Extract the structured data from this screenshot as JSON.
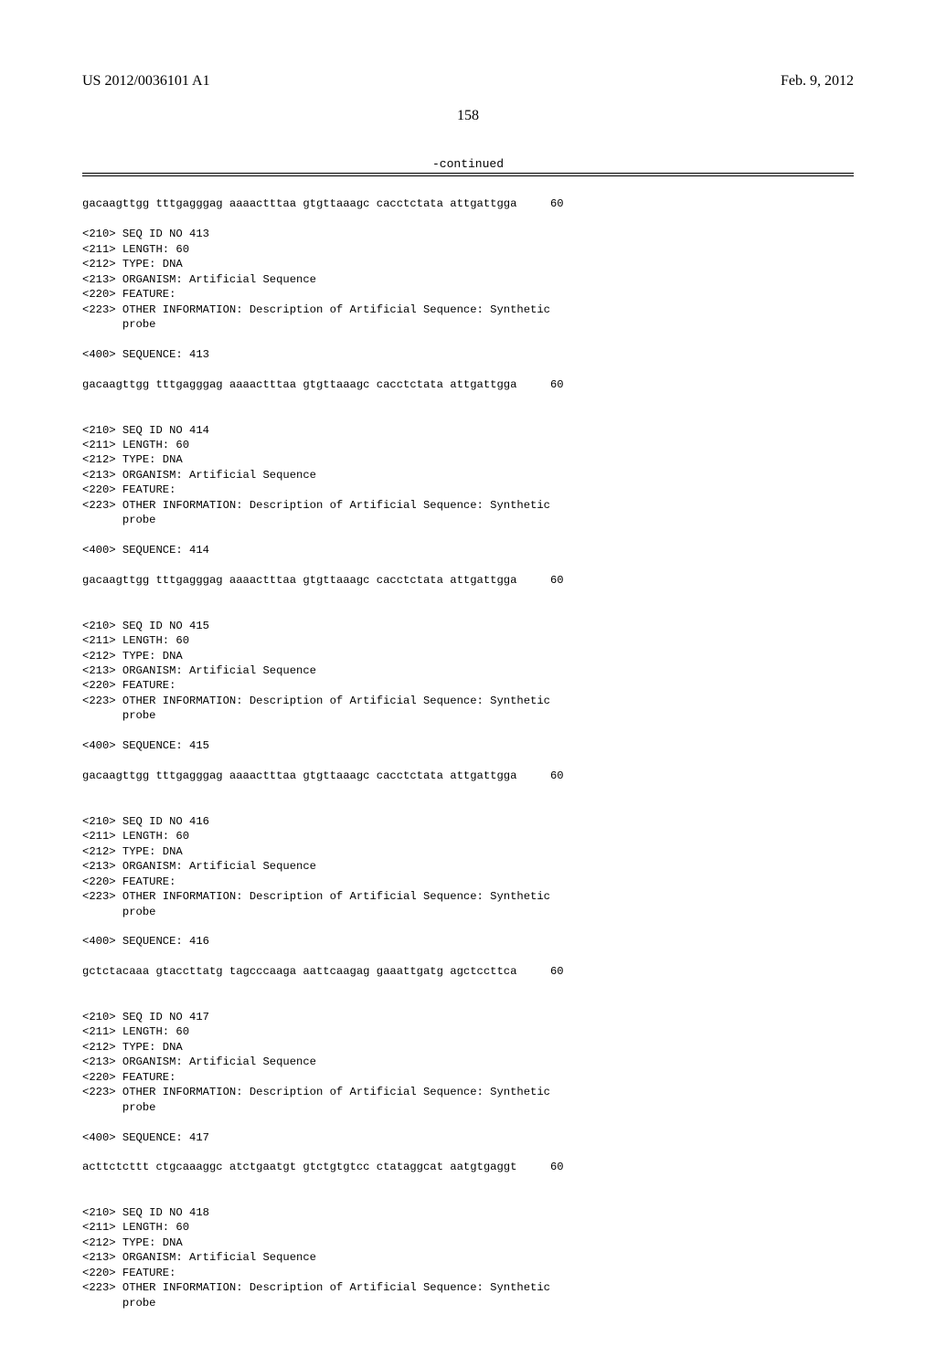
{
  "header": {
    "pub_number": "US 2012/0036101 A1",
    "pub_date": "Feb. 9, 2012"
  },
  "page_number": "158",
  "continued_label": "-continued",
  "entries": [
    {
      "pre_sequence": {
        "text": "gacaagttgg tttgagggag aaaactttaa gtgttaaagc cacctctata attgattgga",
        "num": "60"
      },
      "header": [
        "<210> SEQ ID NO 413",
        "<211> LENGTH: 60",
        "<212> TYPE: DNA",
        "<213> ORGANISM: Artificial Sequence",
        "<220> FEATURE:",
        "<223> OTHER INFORMATION: Description of Artificial Sequence: Synthetic",
        "      probe"
      ],
      "seq_label": "<400> SEQUENCE: 413",
      "sequence": {
        "text": "gacaagttgg tttgagggag aaaactttaa gtgttaaagc cacctctata attgattgga",
        "num": "60"
      }
    },
    {
      "header": [
        "<210> SEQ ID NO 414",
        "<211> LENGTH: 60",
        "<212> TYPE: DNA",
        "<213> ORGANISM: Artificial Sequence",
        "<220> FEATURE:",
        "<223> OTHER INFORMATION: Description of Artificial Sequence: Synthetic",
        "      probe"
      ],
      "seq_label": "<400> SEQUENCE: 414",
      "sequence": {
        "text": "gacaagttgg tttgagggag aaaactttaa gtgttaaagc cacctctata attgattgga",
        "num": "60"
      }
    },
    {
      "header": [
        "<210> SEQ ID NO 415",
        "<211> LENGTH: 60",
        "<212> TYPE: DNA",
        "<213> ORGANISM: Artificial Sequence",
        "<220> FEATURE:",
        "<223> OTHER INFORMATION: Description of Artificial Sequence: Synthetic",
        "      probe"
      ],
      "seq_label": "<400> SEQUENCE: 415",
      "sequence": {
        "text": "gacaagttgg tttgagggag aaaactttaa gtgttaaagc cacctctata attgattgga",
        "num": "60"
      }
    },
    {
      "header": [
        "<210> SEQ ID NO 416",
        "<211> LENGTH: 60",
        "<212> TYPE: DNA",
        "<213> ORGANISM: Artificial Sequence",
        "<220> FEATURE:",
        "<223> OTHER INFORMATION: Description of Artificial Sequence: Synthetic",
        "      probe"
      ],
      "seq_label": "<400> SEQUENCE: 416",
      "sequence": {
        "text": "gctctacaaa gtaccttatg tagcccaaga aattcaagag gaaattgatg agctccttca",
        "num": "60"
      }
    },
    {
      "header": [
        "<210> SEQ ID NO 417",
        "<211> LENGTH: 60",
        "<212> TYPE: DNA",
        "<213> ORGANISM: Artificial Sequence",
        "<220> FEATURE:",
        "<223> OTHER INFORMATION: Description of Artificial Sequence: Synthetic",
        "      probe"
      ],
      "seq_label": "<400> SEQUENCE: 417",
      "sequence": {
        "text": "acttctcttt ctgcaaaggc atctgaatgt gtctgtgtcc ctataggcat aatgtgaggt",
        "num": "60"
      }
    },
    {
      "header": [
        "<210> SEQ ID NO 418",
        "<211> LENGTH: 60",
        "<212> TYPE: DNA",
        "<213> ORGANISM: Artificial Sequence",
        "<220> FEATURE:",
        "<223> OTHER INFORMATION: Description of Artificial Sequence: Synthetic",
        "      probe"
      ],
      "seq_label": "",
      "sequence": null
    }
  ]
}
